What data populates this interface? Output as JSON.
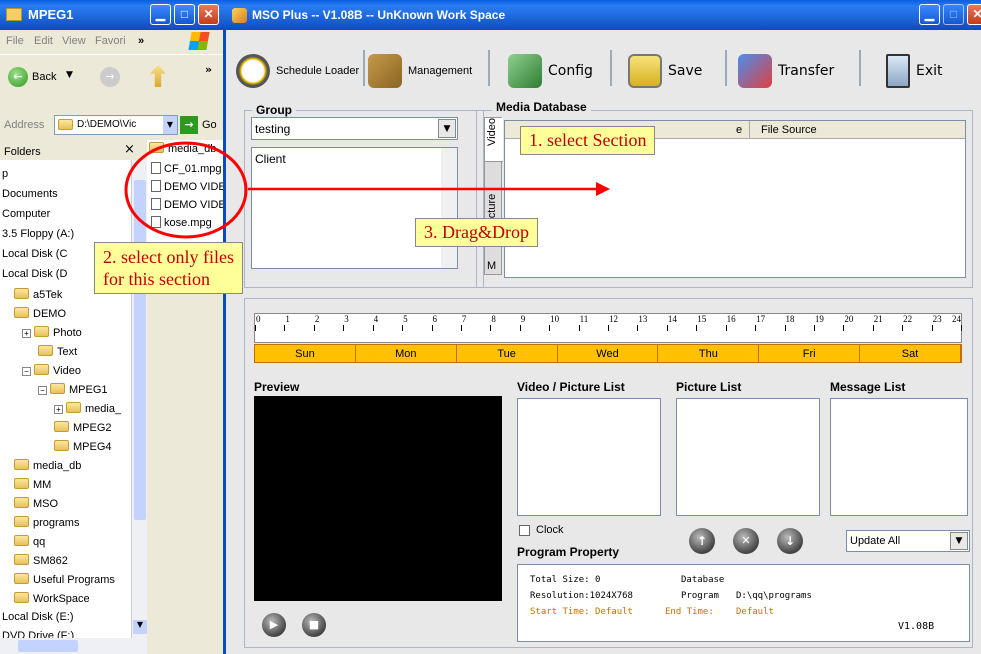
{
  "explorer": {
    "title": "MPEG1",
    "menu": [
      "File",
      "Edit",
      "View",
      "Favori",
      "»"
    ],
    "back_label": "Back",
    "address_label": "Address",
    "address_value": "D:\\DEMO\\Vic",
    "go_label": "Go",
    "folders_label": "Folders",
    "close_glyph": "×",
    "tree": [
      "p",
      "Documents",
      "Computer",
      "3.5 Floppy (A:)",
      "Local Disk (C",
      "Local Disk (D",
      "a5Tek",
      "DEMO",
      "Photo",
      "Text",
      "Video",
      "MPEG1",
      "media_",
      "MPEG2",
      "MPEG4",
      "media_db",
      "MM",
      "MSO",
      "programs",
      "qq",
      "SM862",
      "Useful Programs",
      "WorkSpace",
      "Local Disk (E:)",
      "DVD Drive (F:)"
    ],
    "files": [
      "media_db",
      "CF_01.mpg",
      "DEMO VIDE",
      "DEMO VIDE",
      "kose.mpg"
    ]
  },
  "app": {
    "title": "MSO Plus -- V1.08B -- UnKnown Work Space",
    "toolbar": {
      "schedule_loader": "Schedule Loader",
      "management": "Management",
      "config": "Config",
      "save": "Save",
      "transfer": "Transfer",
      "exit": "Exit"
    },
    "group": {
      "legend": "Group",
      "selected": "testing",
      "list": [
        "Client"
      ]
    },
    "media_db": {
      "legend": "Media Database",
      "tabs": [
        "Video",
        "Picture",
        "M"
      ],
      "col_partial": "e",
      "col_source": "File Source"
    },
    "schedule": {
      "hours": [
        "0",
        "1",
        "2",
        "3",
        "4",
        "5",
        "6",
        "7",
        "8",
        "9",
        "10",
        "11",
        "12",
        "13",
        "14",
        "15",
        "16",
        "17",
        "18",
        "19",
        "20",
        "21",
        "22",
        "23",
        "24"
      ],
      "days": [
        "Sun",
        "Mon",
        "Tue",
        "Wed",
        "Thu",
        "Fri",
        "Sat"
      ]
    },
    "preview_label": "Preview",
    "video_picture_list": "Video / Picture List",
    "picture_list": "Picture List",
    "message_list": "Message List",
    "clock_label": "Clock",
    "update_select": "Update All",
    "program_property": "Program Property",
    "info": {
      "total_size": "Total Size:  0",
      "database_label": "Database",
      "resolution": "Resolution:1024X768",
      "program_label": "Program",
      "program_value": "D:\\qq\\programs",
      "start_time": "Start Time:  Default",
      "end_time": "End Time:",
      "end_value": "Default",
      "version": "V1.08B"
    }
  },
  "annotations": {
    "step1": "1. select Section",
    "step2_line1": "2. select only files",
    "step2_line2": "for this section",
    "step3": "3. Drag&Drop"
  },
  "colors": {
    "annotation_text": "#c00000",
    "callout_bg": "#ffff99",
    "timeline": "#ffc000",
    "arrow": "#ff0000"
  }
}
